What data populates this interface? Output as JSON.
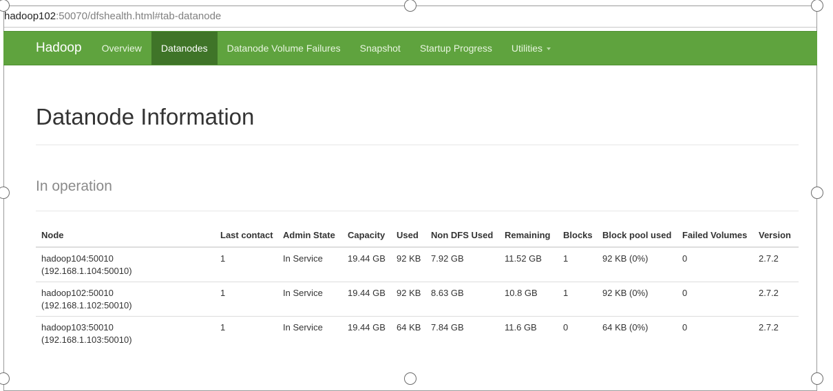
{
  "browser": {
    "url_host": "hadoop102",
    "url_rest": ":50070/dfshealth.html#tab-datanode"
  },
  "navbar": {
    "brand": "Hadoop",
    "items": [
      {
        "label": "Overview"
      },
      {
        "label": "Datanodes"
      },
      {
        "label": "Datanode Volume Failures"
      },
      {
        "label": "Snapshot"
      },
      {
        "label": "Startup Progress"
      },
      {
        "label": "Utilities"
      }
    ],
    "active": "Datanodes",
    "bg_color": "#5fa33e",
    "active_color": "#3f7428"
  },
  "page": {
    "title": "Datanode Information",
    "section": "In operation"
  },
  "table": {
    "headers": {
      "node": "Node",
      "last_contact": "Last contact",
      "admin_state": "Admin State",
      "capacity": "Capacity",
      "used": "Used",
      "non_dfs_used": "Non DFS Used",
      "remaining": "Remaining",
      "blocks": "Blocks",
      "block_pool_used": "Block pool used",
      "failed_volumes": "Failed Volumes",
      "version": "Version"
    },
    "rows": [
      {
        "node": "hadoop104:50010",
        "node_addr": "(192.168.1.104:50010)",
        "last_contact": "1",
        "admin_state": "In Service",
        "capacity": "19.44 GB",
        "used": "92 KB",
        "non_dfs_used": "7.92 GB",
        "remaining": "11.52 GB",
        "blocks": "1",
        "block_pool_used": "92 KB (0%)",
        "failed_volumes": "0",
        "version": "2.7.2"
      },
      {
        "node": "hadoop102:50010",
        "node_addr": "(192.168.1.102:50010)",
        "last_contact": "1",
        "admin_state": "In Service",
        "capacity": "19.44 GB",
        "used": "92 KB",
        "non_dfs_used": "8.63 GB",
        "remaining": "10.8 GB",
        "blocks": "1",
        "block_pool_used": "92 KB (0%)",
        "failed_volumes": "0",
        "version": "2.7.2"
      },
      {
        "node": "hadoop103:50010",
        "node_addr": "(192.168.1.103:50010)",
        "last_contact": "1",
        "admin_state": "In Service",
        "capacity": "19.44 GB",
        "used": "64 KB",
        "non_dfs_used": "7.84 GB",
        "remaining": "11.6 GB",
        "blocks": "0",
        "block_pool_used": "64 KB (0%)",
        "failed_volumes": "0",
        "version": "2.7.2"
      }
    ]
  }
}
